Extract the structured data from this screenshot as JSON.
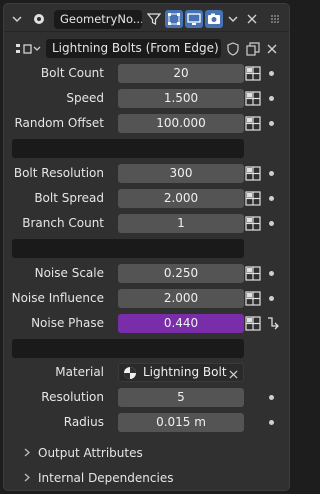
{
  "header": {
    "tab_name": "GeometryNo...",
    "icons": [
      "collapse-chevron-icon",
      "geometry-nodes-modifier-icon",
      "funnel-icon",
      "edit-mode-icon",
      "realtime-icon",
      "render-icon",
      "dropdown-chevron-icon",
      "close-icon"
    ]
  },
  "node_group": {
    "name": "Lightning Bolts (From Edge)",
    "icons": [
      "node-tree-icon",
      "fake-user-shield-icon",
      "duplicate-icon",
      "unlink-close-icon"
    ]
  },
  "inputs": [
    {
      "label": "Bolt Count",
      "value": "20"
    },
    {
      "label": "Speed",
      "value": "1.500"
    },
    {
      "label": "Random Offset",
      "value": "100.000"
    },
    {
      "label": "Bolt Resolution",
      "value": "300"
    },
    {
      "label": "Bolt Spread",
      "value": "2.000"
    },
    {
      "label": "Branch Count",
      "value": "1"
    },
    {
      "label": "Noise Scale",
      "value": "0.250"
    },
    {
      "label": "Noise Influence",
      "value": "2.000"
    },
    {
      "label": "Noise Phase",
      "value": "0.440"
    },
    {
      "label": "Material",
      "value": "Lightning Bolt"
    },
    {
      "label": "Resolution",
      "value": "5"
    },
    {
      "label": "Radius",
      "value": "0.015 m"
    }
  ],
  "subpanels": [
    "Output Attributes",
    "Internal Dependencies"
  ],
  "colors": {
    "panel": "#303030",
    "field": "#545454",
    "active_field": "#7a2da8",
    "selected_toggle": "#4772b3"
  }
}
